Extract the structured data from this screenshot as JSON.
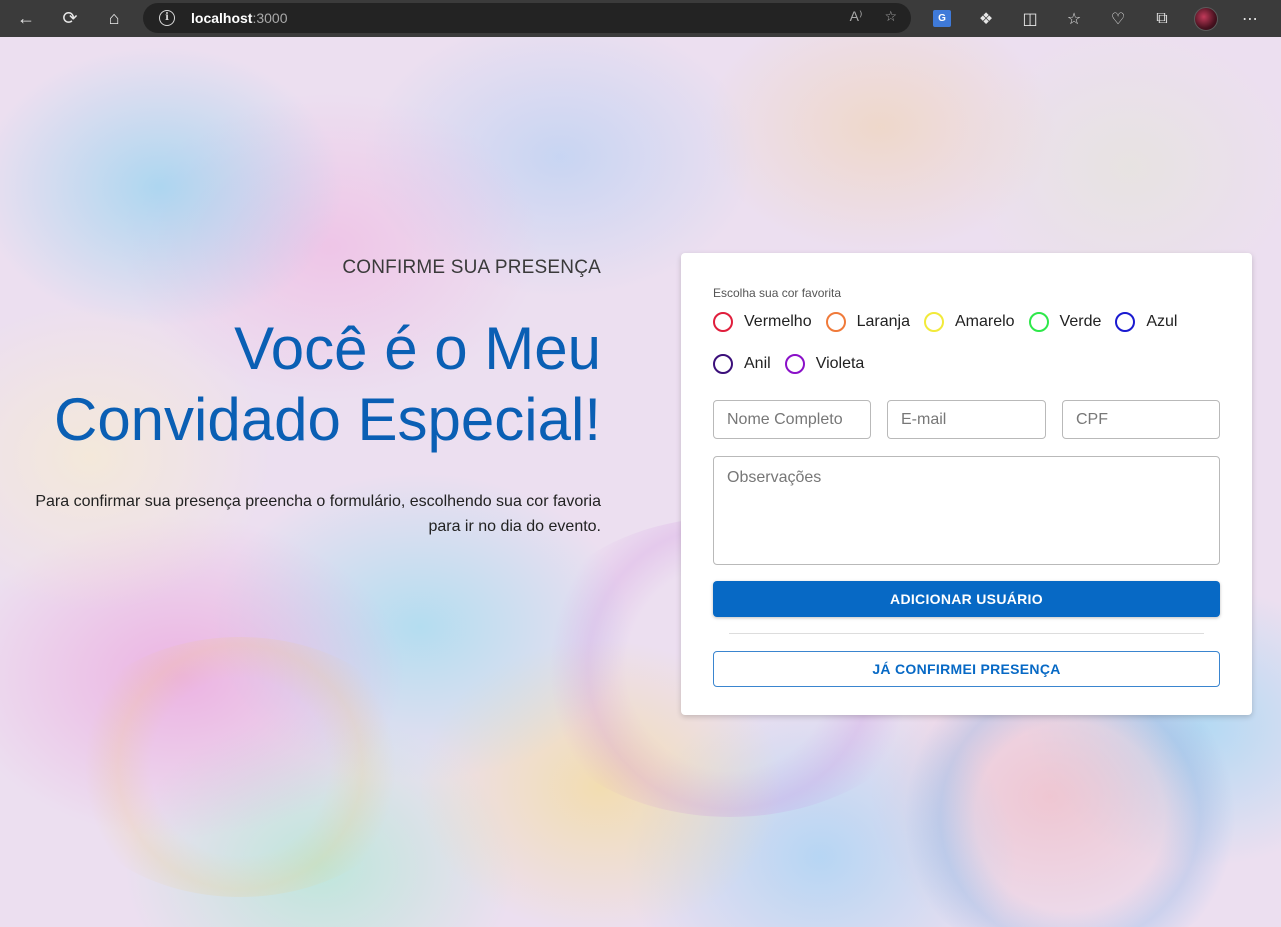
{
  "browser": {
    "url_host": "localhost",
    "url_port": ":3000",
    "translate_badge": "G"
  },
  "hero": {
    "eyebrow": "CONFIRME SUA PRESENÇA",
    "headline_line1": "Você é o Meu",
    "headline_line2": "Convidado Especial!",
    "description": "Para confirmar sua presença preencha o formulário, escolhendo sua cor favoria para ir no dia do evento."
  },
  "form": {
    "legend": "Escolha sua cor favorita",
    "colors": [
      {
        "label": "Vermelho",
        "color": "#e01e3c"
      },
      {
        "label": "Laranja",
        "color": "#f07a3a"
      },
      {
        "label": "Amarelo",
        "color": "#f2ea3a"
      },
      {
        "label": "Verde",
        "color": "#2ee84a"
      },
      {
        "label": "Azul",
        "color": "#1a1ad0"
      },
      {
        "label": "Anil",
        "color": "#3b0f7a"
      },
      {
        "label": "Violeta",
        "color": "#8a10c8"
      }
    ],
    "name_placeholder": "Nome Completo",
    "email_placeholder": "E-mail",
    "cpf_placeholder": "CPF",
    "notes_placeholder": "Observações",
    "submit_label": "ADICIONAR USUÁRIO",
    "confirmed_label": "JÁ CONFIRMEI PRESENÇA"
  },
  "theme": {
    "accent": "#0769c5",
    "headline_color": "#0a5fb4"
  }
}
